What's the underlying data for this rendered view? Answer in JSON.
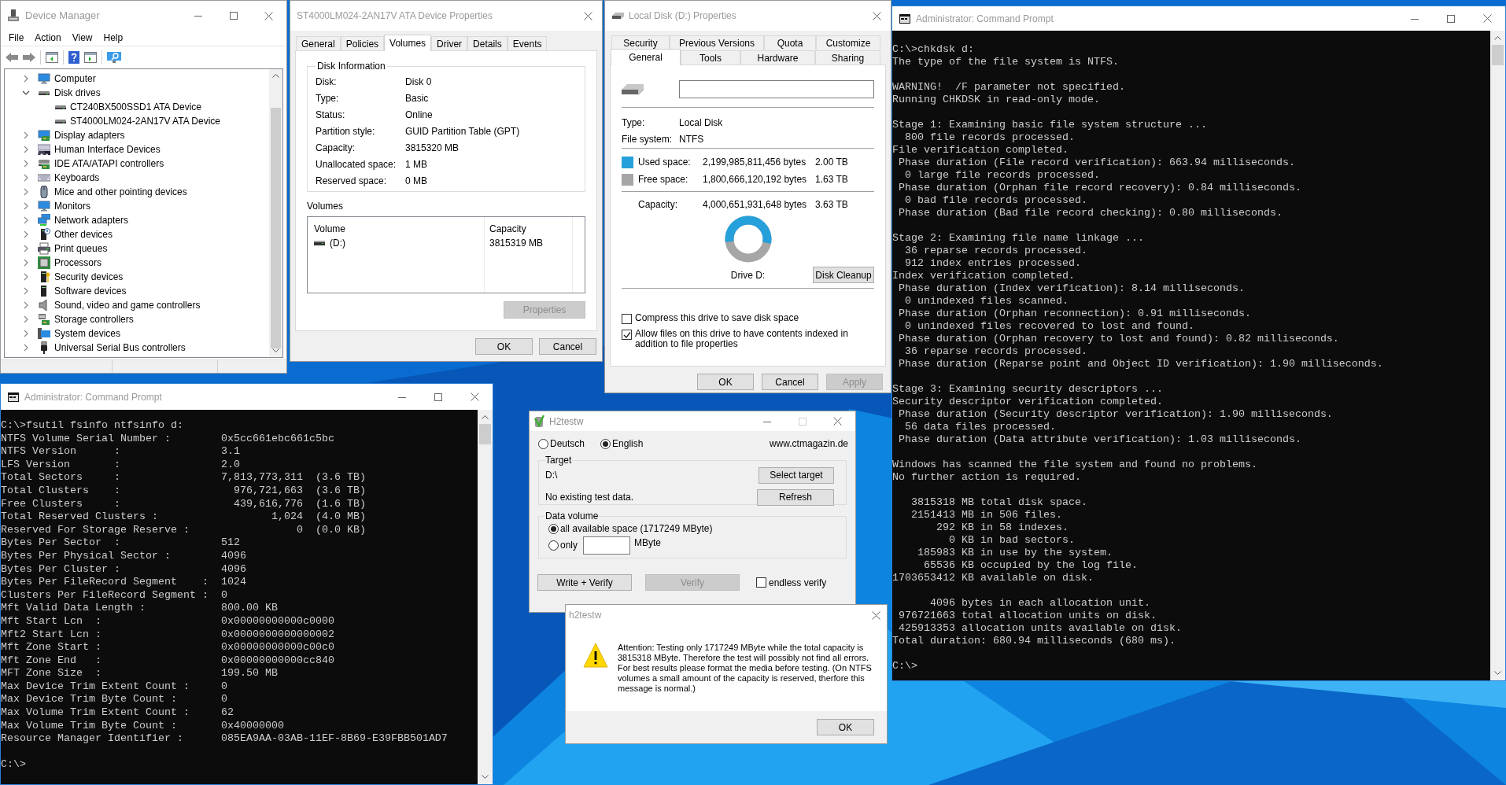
{
  "device_manager": {
    "title": "Device Manager",
    "menu": [
      "File",
      "Action",
      "View",
      "Help"
    ],
    "tree": [
      {
        "label": "Computer",
        "expanded": false
      },
      {
        "label": "Disk drives",
        "expanded": true,
        "children": [
          {
            "label": "CT240BX500SSD1 ATA Device"
          },
          {
            "label": "ST4000LM024-2AN17V ATA Device"
          }
        ]
      },
      {
        "label": "Display adapters",
        "expanded": false
      },
      {
        "label": "Human Interface Devices",
        "expanded": false
      },
      {
        "label": "IDE ATA/ATAPI controllers",
        "expanded": false
      },
      {
        "label": "Keyboards",
        "expanded": false
      },
      {
        "label": "Mice and other pointing devices",
        "expanded": false
      },
      {
        "label": "Monitors",
        "expanded": false
      },
      {
        "label": "Network adapters",
        "expanded": false
      },
      {
        "label": "Other devices",
        "expanded": false
      },
      {
        "label": "Print queues",
        "expanded": false
      },
      {
        "label": "Processors",
        "expanded": false
      },
      {
        "label": "Security devices",
        "expanded": false
      },
      {
        "label": "Software devices",
        "expanded": false
      },
      {
        "label": "Sound, video and game controllers",
        "expanded": false
      },
      {
        "label": "Storage controllers",
        "expanded": false
      },
      {
        "label": "System devices",
        "expanded": false
      },
      {
        "label": "Universal Serial Bus controllers",
        "expanded": false
      }
    ]
  },
  "device_properties": {
    "title": "ST4000LM024-2AN17V ATA Device Properties",
    "tabs": [
      {
        "label": "General",
        "selected": false
      },
      {
        "label": "Policies",
        "selected": false
      },
      {
        "label": "Volumes",
        "selected": true
      },
      {
        "label": "Driver",
        "selected": false
      },
      {
        "label": "Details",
        "selected": false
      },
      {
        "label": "Events",
        "selected": false
      }
    ],
    "disk_information": {
      "legend": "Disk Information",
      "rows": [
        {
          "label": "Disk:",
          "value": "Disk 0"
        },
        {
          "label": "Type:",
          "value": "Basic"
        },
        {
          "label": "Status:",
          "value": "Online"
        },
        {
          "label": "Partition style:",
          "value": "GUID Partition Table (GPT)"
        },
        {
          "label": "Capacity:",
          "value": "3815320 MB"
        },
        {
          "label": "Unallocated space:",
          "value": "1 MB"
        },
        {
          "label": "Reserved space:",
          "value": "0 MB"
        }
      ]
    },
    "volumes": {
      "label": "Volumes",
      "columns": [
        "Volume",
        "Capacity"
      ],
      "rows": [
        {
          "volume": "(D:)",
          "capacity": "3815319 MB"
        }
      ]
    },
    "properties_button": {
      "label": "Properties",
      "disabled": true
    },
    "buttons": [
      {
        "label": "OK",
        "disabled": false
      },
      {
        "label": "Cancel",
        "disabled": false
      }
    ]
  },
  "local_disk_properties": {
    "title": "Local Disk (D:) Properties",
    "tab_rows": [
      [
        {
          "label": "Security",
          "selected": false
        },
        {
          "label": "Previous Versions",
          "selected": false
        },
        {
          "label": "Quota",
          "selected": false
        },
        {
          "label": "Customize",
          "selected": false
        }
      ],
      [
        {
          "label": "General",
          "selected": true
        },
        {
          "label": "Tools",
          "selected": false
        },
        {
          "label": "Hardware",
          "selected": false
        },
        {
          "label": "Sharing",
          "selected": false
        }
      ]
    ],
    "info": [
      {
        "label": "Type:",
        "value": "Local Disk"
      },
      {
        "label": "File system:",
        "value": "NTFS"
      }
    ],
    "space": [
      {
        "label": "Used space:",
        "bytes": "2,199,985,811,456 bytes",
        "size": "2.00 TB",
        "color": "#26a0da"
      },
      {
        "label": "Free space:",
        "bytes": "1,800,666,120,192 bytes",
        "size": "1.63 TB",
        "color": "#a6a6a6"
      }
    ],
    "capacity": {
      "label": "Capacity:",
      "bytes": "4,000,651,931,648 bytes",
      "size": "3.63 TB"
    },
    "drive_label": "Drive D:",
    "cleanup_button": "Disk Cleanup",
    "options": [
      {
        "label": "Compress this drive to save disk space",
        "checked": false
      },
      {
        "label": "Allow files on this drive to have contents indexed in addition to file properties",
        "checked": true
      }
    ],
    "buttons": [
      {
        "label": "OK",
        "disabled": false
      },
      {
        "label": "Cancel",
        "disabled": false
      },
      {
        "label": "Apply",
        "disabled": true
      }
    ]
  },
  "chkdsk_prompt": {
    "title": "Administrator: Command Prompt",
    "blocks": [
      [
        "C:\\>chkdsk d:",
        "The type of the file system is NTFS."
      ],
      [
        "WARNING!  /F parameter not specified.",
        "Running CHKDSK in read-only mode."
      ],
      [
        "Stage 1: Examining basic file system structure ...",
        "  800 file records processed.",
        "File verification completed.",
        " Phase duration (File record verification): 663.94 milliseconds.",
        "  0 large file records processed.",
        " Phase duration (Orphan file record recovery): 0.84 milliseconds.",
        "  0 bad file records processed.",
        " Phase duration (Bad file record checking): 0.80 milliseconds."
      ],
      [
        "Stage 2: Examining file name linkage ...",
        "  36 reparse records processed.",
        "  912 index entries processed.",
        "Index verification completed.",
        " Phase duration (Index verification): 8.14 milliseconds.",
        "  0 unindexed files scanned.",
        " Phase duration (Orphan reconnection): 0.91 milliseconds.",
        "  0 unindexed files recovered to lost and found.",
        " Phase duration (Orphan recovery to lost and found): 0.82 milliseconds.",
        "  36 reparse records processed.",
        " Phase duration (Reparse point and Object ID verification): 1.90 milliseconds."
      ],
      [
        "Stage 3: Examining security descriptors ...",
        "Security descriptor verification completed.",
        " Phase duration (Security descriptor verification): 1.90 milliseconds.",
        "  56 data files processed.",
        " Phase duration (Data attribute verification): 1.03 milliseconds."
      ],
      [
        "Windows has scanned the file system and found no problems.",
        "No further action is required."
      ],
      [
        "   3815318 MB total disk space.",
        "   2151413 MB in 506 files.",
        "       292 KB in 58 indexes.",
        "         0 KB in bad sectors.",
        "    185983 KB in use by the system.",
        "     65536 KB occupied by the log file.",
        "1703653412 KB available on disk."
      ],
      [
        "      4096 bytes in each allocation unit.",
        " 976721663 total allocation units on disk.",
        " 425913353 allocation units available on disk.",
        "Total duration: 680.94 milliseconds (680 ms)."
      ],
      [
        "C:\\>"
      ]
    ]
  },
  "fsutil_prompt": {
    "title": "Administrator: Command Prompt",
    "blocks": [
      [
        "C:\\>fsutil fsinfo ntfsinfo d:",
        "NTFS Volume Serial Number :        0x5cc661ebc661c5bc",
        "NTFS Version      :                3.1",
        "LFS Version       :                2.0",
        "Total Sectors     :                7,813,773,311  (3.6 TB)",
        "Total Clusters    :                  976,721,663  (3.6 TB)",
        "Free Clusters     :                  439,616,776  (1.6 TB)",
        "Total Reserved Clusters :                  1,024  (4.0 MB)",
        "Reserved For Storage Reserve :                 0  (0.0 KB)",
        "Bytes Per Sector  :                512",
        "Bytes Per Physical Sector :        4096",
        "Bytes Per Cluster :                4096",
        "Bytes Per FileRecord Segment    :  1024",
        "Clusters Per FileRecord Segment :  0",
        "Mft Valid Data Length :            800.00 KB",
        "Mft Start Lcn  :                   0x00000000000c0000",
        "Mft2 Start Lcn :                   0x0000000000000002",
        "Mft Zone Start :                   0x00000000000c00c0",
        "Mft Zone End   :                   0x00000000000cc840",
        "MFT Zone Size  :                   199.50 MB",
        "Max Device Trim Extent Count :     0",
        "Max Device Trim Byte Count :       0",
        "Max Volume Trim Extent Count :     62",
        "Max Volume Trim Byte Count :       0x40000000",
        "Resource Manager Identifier :      085EA9AA-03AB-11EF-8B69-E39FBB501AD7"
      ],
      [
        "C:\\>"
      ]
    ]
  },
  "h2testw": {
    "title": "H2testw",
    "languages": [
      {
        "label": "Deutsch",
        "selected": false
      },
      {
        "label": "English",
        "selected": true
      }
    ],
    "website": "www.ctmagazin.de",
    "target": {
      "legend": "Target",
      "path": "D:\\",
      "status": "No existing test data.",
      "buttons": [
        "Select target",
        "Refresh"
      ]
    },
    "data_volume": {
      "legend": "Data volume",
      "options": [
        {
          "kind": "all",
          "label": "all available space (1717249 MByte)",
          "selected": true
        },
        {
          "kind": "amount",
          "label": "only",
          "unit": "MByte",
          "selected": false
        }
      ]
    },
    "actions": [
      {
        "label": "Write + Verify",
        "disabled": false
      },
      {
        "label": "Verify",
        "disabled": true
      }
    ],
    "endless_verify": {
      "label": "endless verify",
      "checked": false
    }
  },
  "dialog": {
    "title": "h2testw",
    "message": "Attention: Testing only 1717249 MByte while the total capacity is 3815318 MByte. Therefore the test will possibly not find all errors. For best results please format the media before testing. (On NTFS volumes a small amount of the capacity is reserved, therfore this message is normal.)",
    "button": "OK"
  }
}
